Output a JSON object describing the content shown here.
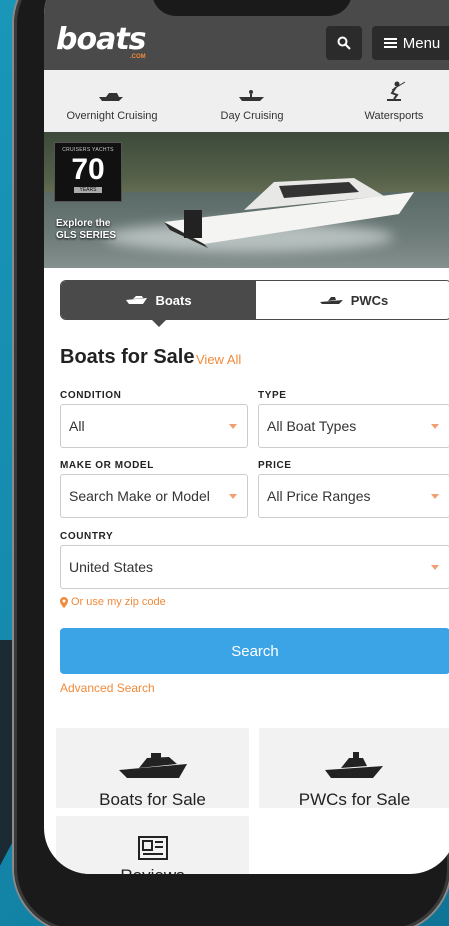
{
  "header": {
    "logo_text": "boats",
    "logo_sub": ".COM",
    "menu_label": "Menu"
  },
  "categories": [
    {
      "label": "Overnight Cruising",
      "icon": "cruiser-boat-icon"
    },
    {
      "label": "Day Cruising",
      "icon": "day-boat-icon"
    },
    {
      "label": "Watersports",
      "icon": "water-skier-icon"
    }
  ],
  "hero": {
    "badge_brand": "CRUISERS YACHTS",
    "badge_number": "70",
    "badge_years": "YEARS",
    "cta_line1": "Explore the",
    "cta_line2": "GLS SERIES"
  },
  "toggle": {
    "boats_label": "Boats",
    "pwcs_label": "PWCs"
  },
  "search_form": {
    "title": "Boats for Sale",
    "view_all": "View All",
    "condition_label": "CONDITION",
    "condition_value": "All",
    "type_label": "TYPE",
    "type_value": "All Boat Types",
    "make_label": "MAKE OR MODEL",
    "make_placeholder": "Search Make or Model",
    "price_label": "PRICE",
    "price_value": "All Price Ranges",
    "country_label": "COUNTRY",
    "country_value": "United States",
    "zip_link": "Or use my zip code",
    "search_button": "Search",
    "advanced_link": "Advanced Search"
  },
  "cards": [
    {
      "label": "Boats for Sale",
      "icon": "yacht-icon"
    },
    {
      "label": "PWCs for Sale",
      "icon": "jet-ski-icon"
    },
    {
      "label": "Reviews",
      "icon": "newspaper-icon"
    }
  ],
  "colors": {
    "header_bg": "#4a4a4a",
    "accent_orange": "#f08a3c",
    "search_blue": "#3ba4e6",
    "background_teal": "#1996b8"
  }
}
